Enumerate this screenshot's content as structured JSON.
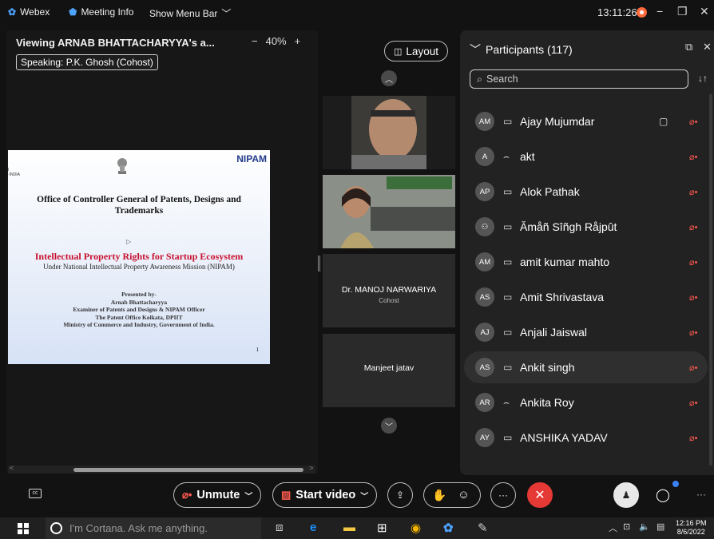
{
  "topbar": {
    "app_name": "Webex",
    "meeting_info": "Meeting Info",
    "show_menu_bar": "Show Menu Bar",
    "time": "13:11:26"
  },
  "share_view": {
    "title": "Viewing ARNAB BHATTACHARYYA's a...",
    "zoom_out": "−",
    "zoom_level": "40%",
    "zoom_in": "+",
    "speaking": "Speaking: P.K. Ghosh (Cohost)"
  },
  "slide": {
    "logo": "NIPAM",
    "office_title": "Office of Controller General of Patents, Designs and Trademarks",
    "headline": "Intellectual Property Rights for Startup Ecosystem",
    "subheadline": "Under National Intellectual Property Awareness Mission (NIPAM)",
    "presented_by": "Presented by-",
    "presenter": "Arnab Bhattacharyya",
    "role": "Examiner of Patents and Designs & NIPAM Officer",
    "office": "The Patent Office Kolkata, DPIIT",
    "ministry": "Ministry of Commerce and Industry, Government of India.",
    "page_number": "1"
  },
  "videos": {
    "layout_label": "Layout",
    "tiles": [
      {
        "name": "",
        "sub": ""
      },
      {
        "name": "",
        "sub": ""
      },
      {
        "name": "Dr. MANOJ NARWARIYA",
        "sub": "Cohost"
      },
      {
        "name": "Manjeet jatav",
        "sub": ""
      }
    ]
  },
  "participants": {
    "header": "Participants (117)",
    "search_placeholder": "Search",
    "list": [
      {
        "initials": "AM",
        "name": "Ajay Mujumdar",
        "device": "tablet",
        "video": true
      },
      {
        "initials": "A",
        "name": "akt",
        "device": "headset",
        "video": false
      },
      {
        "initials": "AP",
        "name": "Alok Pathak",
        "device": "tablet",
        "video": false
      },
      {
        "initials": "",
        "name": "Ămåñ Sîñgh Råjpût",
        "device": "tablet",
        "video": false
      },
      {
        "initials": "AM",
        "name": "amit kumar mahto",
        "device": "tablet",
        "video": false
      },
      {
        "initials": "AS",
        "name": "Amit Shrivastava",
        "device": "tablet",
        "video": false
      },
      {
        "initials": "AJ",
        "name": "Anjali Jaiswal",
        "device": "tablet",
        "video": false
      },
      {
        "initials": "AS",
        "name": "Ankit singh",
        "device": "tablet",
        "video": false
      },
      {
        "initials": "AR",
        "name": "Ankita Roy",
        "device": "headset",
        "video": false
      },
      {
        "initials": "AY",
        "name": "ANSHIKA YADAV",
        "device": "tablet",
        "video": false
      }
    ]
  },
  "controls": {
    "unmute": "Unmute",
    "start_video": "Start video",
    "more": "···"
  },
  "taskbar": {
    "cortana": "I'm Cortana. Ask me anything.",
    "time": "12:16 PM",
    "date": "8/6/2022"
  },
  "colors": {
    "accent": "#3b82f6",
    "end_call": "#e53935",
    "muted": "#ff5a4f"
  }
}
